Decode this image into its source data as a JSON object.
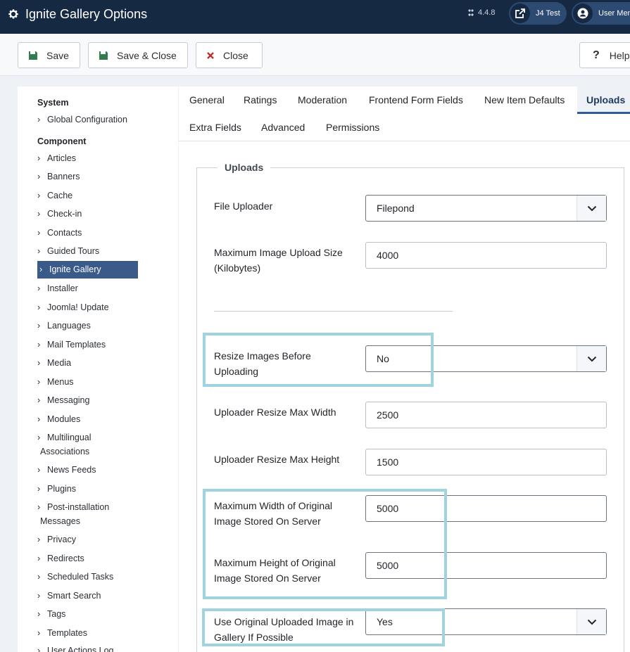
{
  "header": {
    "title": "Ignite Gallery Options",
    "version": "4.4.8",
    "site_button": "J4 Test",
    "user_button": "User Menu"
  },
  "toolbar": {
    "save": "Save",
    "save_close": "Save & Close",
    "close": "Close",
    "help": "Help"
  },
  "sidebar": {
    "system_heading": "System",
    "system_items": [
      "Global Configuration"
    ],
    "component_heading": "Component",
    "items": [
      "Articles",
      "Banners",
      "Cache",
      "Check-in",
      "Contacts",
      "Guided Tours",
      "Ignite Gallery",
      "Installer",
      "Joomla! Update",
      "Languages",
      "Mail Templates",
      "Media",
      "Menus",
      "Messaging",
      "Modules",
      "Multilingual",
      "Associations",
      "News Feeds",
      "Plugins",
      "Post-installation",
      "Messages",
      "Privacy",
      "Redirects",
      "Scheduled Tasks",
      "Smart Search",
      "Tags",
      "Templates",
      "User Actions Log"
    ],
    "active_item": "Ignite Gallery"
  },
  "tabs": [
    "General",
    "Ratings",
    "Moderation",
    "Frontend Form Fields",
    "New Item Defaults",
    "Uploads",
    "Extra Fields",
    "Advanced",
    "Permissions"
  ],
  "active_tab": "Uploads",
  "form": {
    "legend": "Uploads",
    "file_uploader": {
      "label": "File Uploader",
      "value": "Filepond"
    },
    "max_upload_size": {
      "label": "Maximum Image Upload Size (Kilobytes)",
      "value": "4000"
    },
    "resize_before_upload": {
      "label": "Resize Images Before Uploading",
      "value": "No"
    },
    "resize_max_width": {
      "label": "Uploader Resize Max Width",
      "value": "2500"
    },
    "resize_max_height": {
      "label": "Uploader Resize Max Height",
      "value": "1500"
    },
    "max_original_width": {
      "label": "Maximum Width of Original Image Stored On Server",
      "value": "5000"
    },
    "max_original_height": {
      "label": "Maximum Height of Original Image Stored On Server",
      "value": "5000"
    },
    "use_original": {
      "label": "Use Original Uploaded Image in Gallery If Possible",
      "value": "Yes"
    }
  },
  "colors": {
    "header_bg": "#152943",
    "accent": "#2d5c9b",
    "highlight": "#9fd3e0"
  }
}
